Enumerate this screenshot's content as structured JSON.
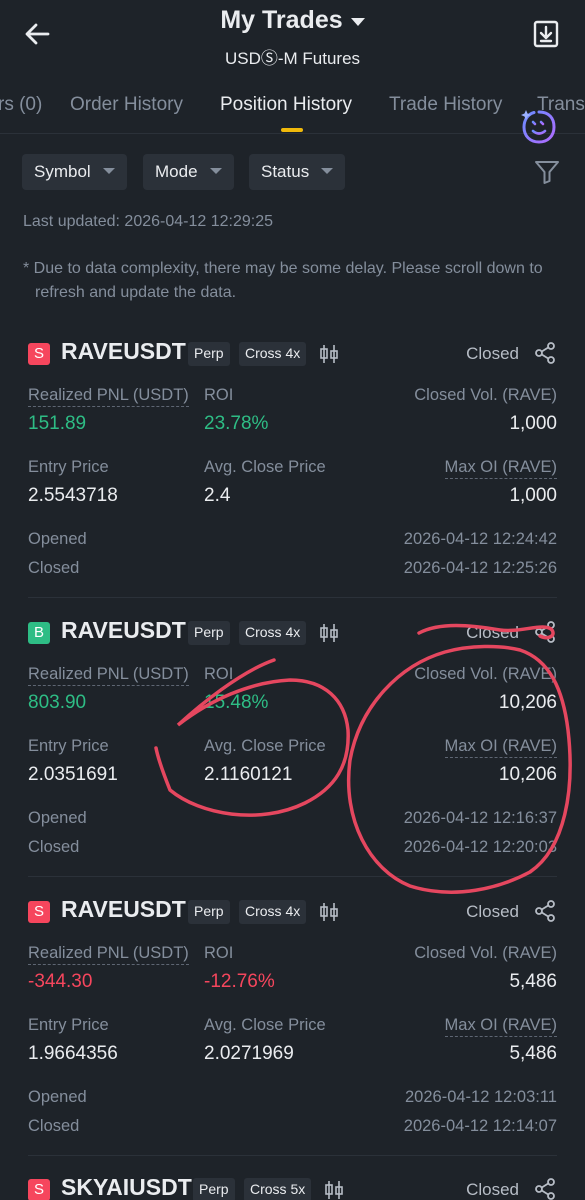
{
  "header": {
    "title": "My Trades",
    "subtitle": "USDⓈ-M Futures"
  },
  "tabs": [
    {
      "label": "rs (0)"
    },
    {
      "label": "Order History"
    },
    {
      "label": "Position History"
    },
    {
      "label": "Trade History"
    },
    {
      "label": "Trans"
    }
  ],
  "filters": [
    {
      "label": "Symbol"
    },
    {
      "label": "Mode"
    },
    {
      "label": "Status"
    }
  ],
  "last_updated": "Last updated: 2026-04-12 12:29:25",
  "disclaimer": "* Due to data complexity, there may be some delay. Please scroll down to refresh and update the data.",
  "labels": {
    "pnl": "Realized PNL (USDT)",
    "roi": "ROI",
    "entry": "Entry Price",
    "avg_close": "Avg. Close Price",
    "opened": "Opened",
    "closed": "Closed"
  },
  "positions": [
    {
      "side": "S",
      "symbol": "RAVEUSDT",
      "type": "Perp",
      "margin": "Cross 4x",
      "status": "Closed",
      "pnl": "151.89",
      "roi": "23.78%",
      "closed_vol_label": "Closed Vol. (RAVE)",
      "closed_vol": "1,000",
      "entry_price": "2.5543718",
      "avg_close_price": "2.4",
      "max_oi_label": "Max OI (RAVE)",
      "max_oi": "1,000",
      "opened_time": "2026-04-12 12:24:42",
      "closed_time": "2026-04-12 12:25:26"
    },
    {
      "side": "B",
      "symbol": "RAVEUSDT",
      "type": "Perp",
      "margin": "Cross 4x",
      "status": "Closed",
      "pnl": "803.90",
      "roi": "15.48%",
      "closed_vol_label": "Closed Vol. (RAVE)",
      "closed_vol": "10,206",
      "entry_price": "2.0351691",
      "avg_close_price": "2.1160121",
      "max_oi_label": "Max OI (RAVE)",
      "max_oi": "10,206",
      "opened_time": "2026-04-12 12:16:37",
      "closed_time": "2026-04-12 12:20:03"
    },
    {
      "side": "S",
      "symbol": "RAVEUSDT",
      "type": "Perp",
      "margin": "Cross 4x",
      "status": "Closed",
      "pnl": "-344.30",
      "roi": "-12.76%",
      "closed_vol_label": "Closed Vol. (RAVE)",
      "closed_vol": "5,486",
      "entry_price": "1.9664356",
      "avg_close_price": "2.0271969",
      "max_oi_label": "Max OI (RAVE)",
      "max_oi": "5,486",
      "opened_time": "2026-04-12 12:03:11",
      "closed_time": "2026-04-12 12:14:07"
    },
    {
      "side": "S",
      "symbol": "SKYAIUSDT",
      "type": "Perp",
      "margin": "Cross 5x",
      "status": "Closed"
    }
  ],
  "colors": {
    "background": "#1e2329",
    "accent": "#f0b90b",
    "positive": "#2ebd85",
    "negative": "#f6465d",
    "annotation": "#e5475f"
  }
}
